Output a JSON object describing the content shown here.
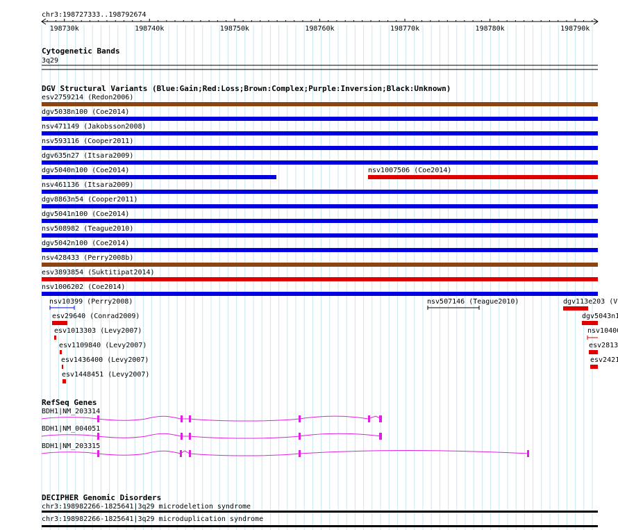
{
  "ruler": {
    "position": "chr3:198727333..198792674",
    "ticks": [
      {
        "kb": 198730,
        "label": "198730k"
      },
      {
        "kb": 198740,
        "label": "198740k"
      },
      {
        "kb": 198750,
        "label": "198750k"
      },
      {
        "kb": 198760,
        "label": "198760k"
      },
      {
        "kb": 198770,
        "label": "198770k"
      },
      {
        "kb": 198780,
        "label": "198780k"
      },
      {
        "kb": 198790,
        "label": "198790k"
      }
    ]
  },
  "cyto": {
    "title": "Cytogenetic Bands",
    "band": "3q29"
  },
  "dgv": {
    "title": "DGV Structural Variants (Blue:Gain;Red:Loss;Brown:Complex;Purple:Inversion;Black:Unknown)",
    "colors": {
      "gain": "#0000e0",
      "loss": "#e00000",
      "complex": "#8b4513",
      "unknown": "#000000"
    },
    "full_rows": [
      {
        "label": "esv2759214 (Redon2006)",
        "type": "complex"
      },
      {
        "label": "dgv5038n100 (Coe2014)",
        "type": "gain"
      },
      {
        "label": "nsv471149 (Jakobsson2008)",
        "type": "gain"
      },
      {
        "label": "nsv593116 (Cooper2011)",
        "type": "gain"
      },
      {
        "label": "dgv635n27 (Itsara2009)",
        "type": "gain"
      },
      {
        "label": "dgv5040n100 (Coe2014)",
        "type": "gain"
      },
      {
        "label": "nsv461136 (Itsara2009)",
        "type": "gain"
      },
      {
        "label": "dgv8863n54 (Cooper2011)",
        "type": "gain"
      },
      {
        "label": "dgv5041n100 (Coe2014)",
        "type": "gain"
      },
      {
        "label": "nsv508982 (Teague2010)",
        "type": "gain"
      },
      {
        "label": "dgv5042n100 (Coe2014)",
        "type": "gain"
      },
      {
        "label": "nsv428433 (Perry2008b)",
        "type": "complex"
      },
      {
        "label": "esv3893854 (Suktitipat2014)",
        "type": "loss"
      },
      {
        "label": "nsv1006202 (Coe2014)",
        "type": "gain"
      }
    ],
    "nsv1007506": {
      "label": "nsv1007506 (Coe2014)",
      "type": "loss"
    },
    "small": [
      {
        "label": "nsv10399 (Perry2008)",
        "type": "unknown"
      },
      {
        "label": "esv29640 (Conrad2009)",
        "type": "loss"
      },
      {
        "label": "esv1013303 (Levy2007)",
        "type": "loss"
      },
      {
        "label": "esv1109840 (Levy2007)",
        "type": "loss"
      },
      {
        "label": "esv1436400 (Levy2007)",
        "type": "loss"
      },
      {
        "label": "esv1448451 (Levy2007)",
        "type": "loss"
      },
      {
        "label": "nsv507146 (Teague2010)",
        "type": "unknown"
      },
      {
        "label": "dgv113e203 (Vo",
        "type": "loss"
      },
      {
        "label": "dgv5043n1",
        "type": "loss"
      },
      {
        "label": "nsv10400",
        "type": "loss"
      },
      {
        "label": "esv2813",
        "type": "loss"
      },
      {
        "label": "esv2421",
        "type": "loss"
      }
    ]
  },
  "refseq": {
    "title": "RefSeq Genes",
    "color": "#e020e0",
    "genes": [
      {
        "label": "BDH1|NM_203314"
      },
      {
        "label": "BDH1|NM_004051"
      },
      {
        "label": "BDH1|NM_203315"
      }
    ]
  },
  "decipher": {
    "title": "DECIPHER Genomic Disorders",
    "items": [
      {
        "label": "chr3:198982266-1825641|3q29 microdeletion syndrome"
      },
      {
        "label": "chr3:198982266-1825641|3q29 microduplication syndrome"
      }
    ]
  }
}
